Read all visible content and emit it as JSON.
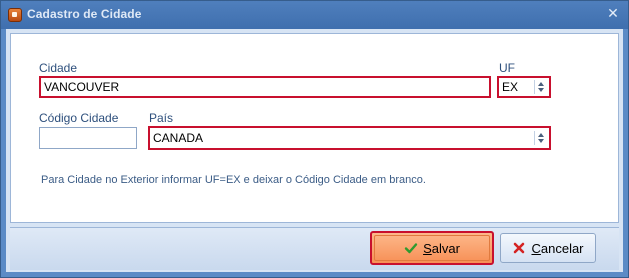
{
  "window": {
    "title": "Cadastro de Cidade",
    "close_glyph": "✕"
  },
  "form": {
    "cidade": {
      "label": "Cidade",
      "value": "VANCOUVER"
    },
    "uf": {
      "label": "UF",
      "value": "EX"
    },
    "codigo_cidade": {
      "label": "Código Cidade",
      "value": ""
    },
    "pais": {
      "label": "País",
      "value": "CANADA"
    },
    "hint": "Para Cidade no Exterior informar UF=EX e deixar o Código Cidade em branco."
  },
  "buttons": {
    "save": {
      "accel": "S",
      "rest": "alvar",
      "icon": "check-icon"
    },
    "cancel": {
      "accel": "C",
      "rest": "ancelar",
      "icon": "x-icon"
    }
  },
  "colors": {
    "highlight": "#c8102e",
    "title_bar": "#4f7fbd",
    "label_text": "#2d4f7c"
  }
}
